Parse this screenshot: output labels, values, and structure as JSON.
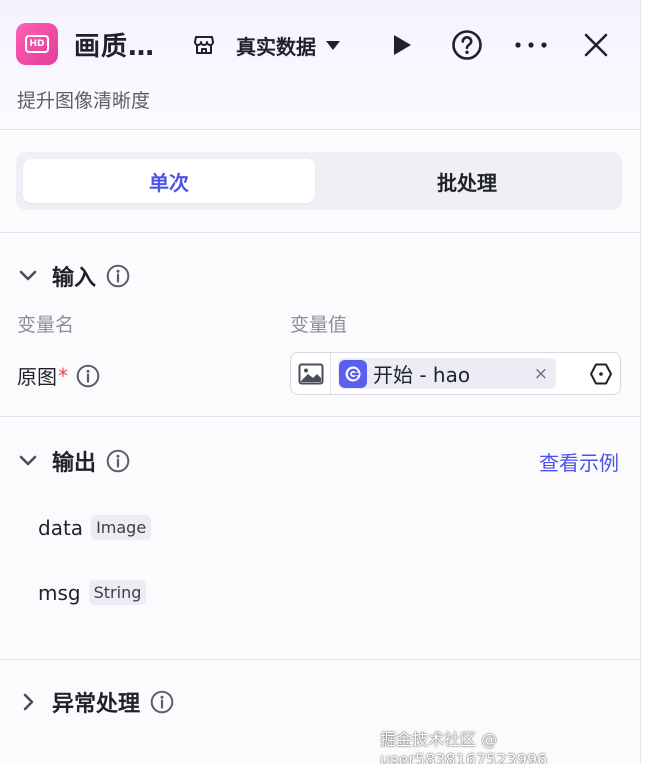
{
  "header": {
    "title": "画质…",
    "hd_badge": "HD",
    "data_source_label": "真实数据",
    "subtitle": "提升图像清晰度"
  },
  "tabs": [
    {
      "label": "单次",
      "active": true
    },
    {
      "label": "批处理",
      "active": false
    }
  ],
  "input_section": {
    "title": "输入",
    "col_name": "变量名",
    "col_value": "变量值",
    "rows": [
      {
        "name": "原图",
        "required_mark": "*",
        "ref_text": "开始 - hao",
        "clear": "×"
      }
    ]
  },
  "output_section": {
    "title": "输出",
    "view_example": "查看示例",
    "items": [
      {
        "name": "data",
        "type": "Image"
      },
      {
        "name": "msg",
        "type": "String"
      }
    ]
  },
  "exception_section": {
    "title": "异常处理"
  },
  "watermark": "掘金技术社区 @ user5838167523996",
  "colors": {
    "accent": "#4d53e8",
    "brand_pink": "#e23d9a",
    "required": "#e5484d"
  }
}
